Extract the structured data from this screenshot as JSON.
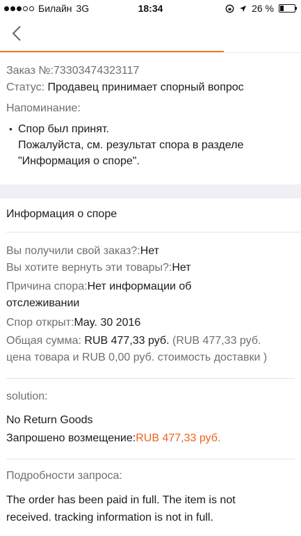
{
  "status_bar": {
    "carrier": "Билайн",
    "network": "3G",
    "time": "18:34",
    "battery_percent": "26 %"
  },
  "order": {
    "number_label": "Заказ №:",
    "number": "73303474323117",
    "status_label": "Статус:",
    "status": "Продавец принимает спорный вопрос",
    "reminder_label": "Напоминание:",
    "reminder_line1": "Спор был принят.",
    "reminder_line2": "Пожалуйста, см. результат спора в разделе",
    "reminder_line3": "\"Информация о споре\"."
  },
  "dispute": {
    "section_title": "Информация о споре",
    "received_label": "Вы получили свой заказ?:",
    "received_value": "Нет",
    "return_label": "Вы хотите вернуть эти товары?:",
    "return_value": "Нет",
    "reason_label": "Причина спора:",
    "reason_value_line1": "Нет информации об",
    "reason_value_line2": "отслеживании",
    "opened_label": "Спор открыт:",
    "opened_value": "May. 30 2016",
    "total_label": "Общая сумма:",
    "total_value": "RUB 477,33 руб.",
    "total_detail_line1": "(RUB 477,33 руб.",
    "total_detail_line2": "цена товара и RUB 0,00 руб. стоимость доставки )"
  },
  "solution": {
    "label": "solution:",
    "value": "No Return Goods",
    "refund_label": "Запрошено возмещение:",
    "refund_value": "RUB 477,33 руб."
  },
  "request": {
    "label": "Подробности запроса:",
    "line1": "The order has been paid in full. The item is not",
    "line2": "received. tracking information is not in full."
  },
  "colors": {
    "accent": "#f0621e",
    "label_gray": "#6f6f6f",
    "band": "#efeff4"
  },
  "icons": {
    "back": "chevron-left-icon",
    "bullet": "bullet-icon"
  }
}
